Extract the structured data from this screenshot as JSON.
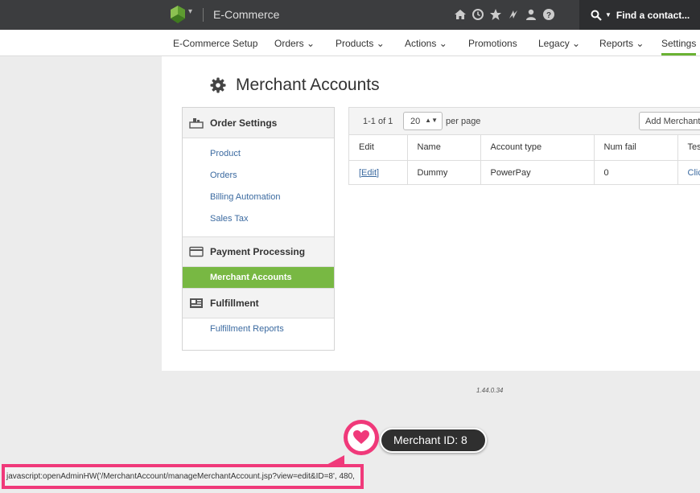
{
  "app": {
    "title": "E-Commerce",
    "search_placeholder": "Find a contact..."
  },
  "nav": [
    {
      "label": "E-Commerce Setup",
      "caret": ""
    },
    {
      "label": "Orders",
      "caret": "⌄"
    },
    {
      "label": "Products",
      "caret": "⌄"
    },
    {
      "label": "Actions",
      "caret": "⌄"
    },
    {
      "label": "Promotions",
      "caret": ""
    },
    {
      "label": "Legacy",
      "caret": "⌄"
    },
    {
      "label": "Reports",
      "caret": "⌄"
    },
    {
      "label": "Settings",
      "caret": ""
    }
  ],
  "page": {
    "title": "Merchant Accounts"
  },
  "sidebar": {
    "order_settings": "Order Settings",
    "product": "Product",
    "orders": "Orders",
    "billing_automation": "Billing Automation",
    "sales_tax": "Sales Tax",
    "payment_processing": "Payment Processing",
    "merchant_accounts": "Merchant Accounts",
    "fulfillment": "Fulfillment",
    "fulfillment_reports": "Fulfillment Reports"
  },
  "table": {
    "range": "1-1 of 1",
    "per_page_value": "20",
    "per_page_label": "per page",
    "add_button": "Add Merchant Account",
    "columns": [
      "Edit",
      "Name",
      "Account type",
      "Num fail",
      "Test"
    ],
    "rows": [
      {
        "edit": "[Edit]",
        "name": "Dummy",
        "account_type": "PowerPay",
        "num_fail": "0",
        "test": "Click"
      }
    ]
  },
  "version": "1.44.0.34",
  "status_bar": "javascript:openAdminHW('/MerchantAccount/manageMerchantAccount.jsp?view=edit&ID=8', 480,",
  "tooltip": "Merchant ID: 8",
  "colors": {
    "accent_green": "#78b843",
    "highlight_pink": "#f0397a",
    "topbar": "#3c3d3f"
  }
}
